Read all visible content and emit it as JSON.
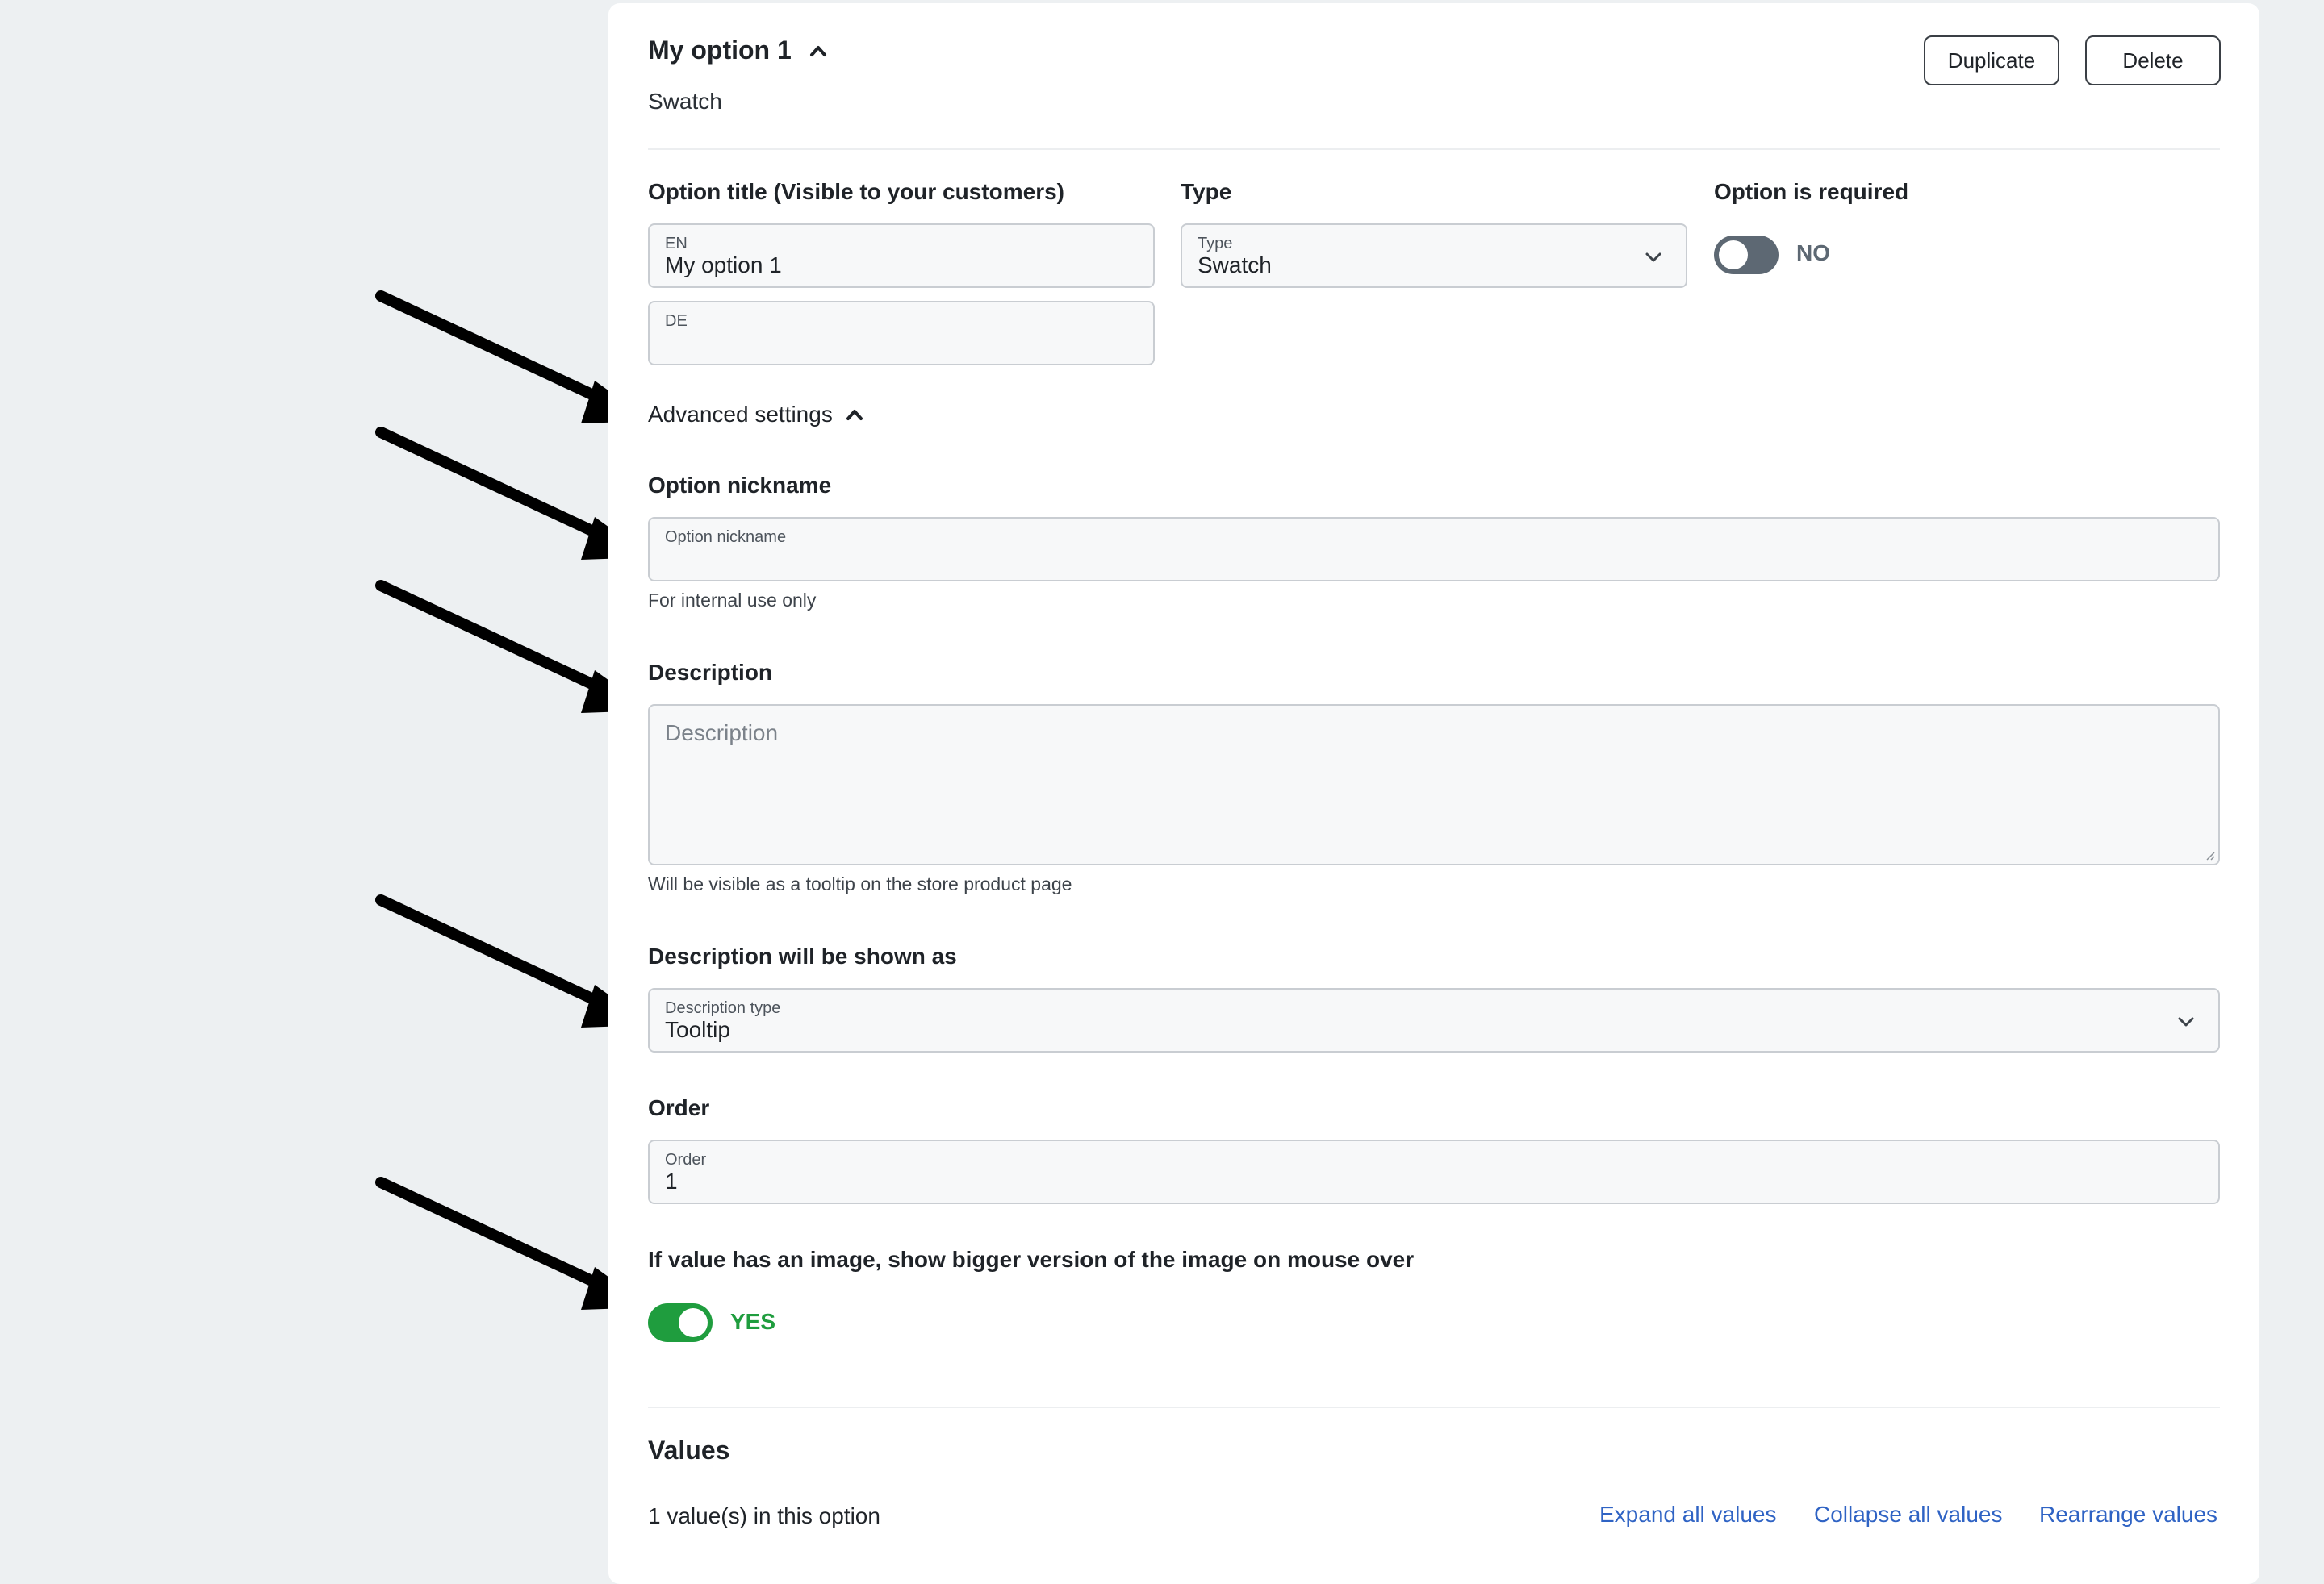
{
  "option": {
    "title": "My option 1",
    "subtitle": "Swatch",
    "duplicate_label": "Duplicate",
    "delete_label": "Delete"
  },
  "fields": {
    "title_label": "Option title (Visible to your customers)",
    "en_mini": "EN",
    "en_value": "My option 1",
    "de_mini": "DE",
    "de_value": "",
    "type_label": "Type",
    "type_mini": "Type",
    "type_value": "Swatch",
    "required_label": "Option is required",
    "required_state": "NO"
  },
  "advanced": {
    "toggle_label": "Advanced settings",
    "nickname_label": "Option nickname",
    "nickname_mini": "Option nickname",
    "nickname_value": "",
    "nickname_help": "For internal use only",
    "description_label": "Description",
    "description_placeholder": "Description",
    "description_help": "Will be visible as a tooltip on the store product page",
    "shown_as_label": "Description will be shown as",
    "desc_type_mini": "Description type",
    "desc_type_value": "Tooltip",
    "order_label": "Order",
    "order_mini": "Order",
    "order_value": "1",
    "hover_label": "If value has an image, show bigger version of the image on mouse over",
    "hover_state": "YES"
  },
  "values_section": {
    "heading": "Values",
    "count_text": "1 value(s) in this option",
    "expand_label": "Expand all values",
    "collapse_label": "Collapse all values",
    "rearrange_label": "Rearrange values"
  },
  "colors": {
    "background": "#edf0f2",
    "toggle_off": "#5d6873",
    "toggle_on": "#1f9d3e",
    "link": "#2f63c4"
  }
}
